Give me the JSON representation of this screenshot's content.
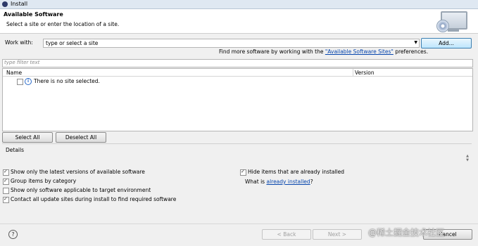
{
  "window": {
    "title": "Install"
  },
  "header": {
    "title": "Available Software",
    "subtitle": "Select a site or enter the location of a site."
  },
  "work_with": {
    "label": "Work with:",
    "value": "type or select a site",
    "add_label": "Add...",
    "more_prefix": "Find more software by working with the ",
    "more_link": "\"Available Software Sites\"",
    "more_suffix": " preferences."
  },
  "filter": {
    "placeholder": "type filter text"
  },
  "table": {
    "columns": [
      "Name",
      "Version"
    ],
    "rows": [
      {
        "name": "There is no site selected.",
        "checked": false
      }
    ]
  },
  "selection": {
    "select_all": "Select All",
    "deselect_all": "Deselect All"
  },
  "details": {
    "label": "Details"
  },
  "options": {
    "latest_versions": {
      "label": "Show only the latest versions of available software",
      "checked": true
    },
    "group_by_category": {
      "label": "Group items by category",
      "checked": true
    },
    "target_env": {
      "label": "Show only software applicable to target environment",
      "checked": false
    },
    "contact_sites": {
      "label": "Contact all update sites during install to find required software",
      "checked": true
    },
    "hide_installed": {
      "label": "Hide items that are already installed",
      "checked": true
    },
    "what_is_prefix": "What is ",
    "what_is_link": "already installed",
    "what_is_suffix": "?"
  },
  "footer": {
    "help": "?",
    "back": "< Back",
    "next": "Next >",
    "cancel": "Cancel"
  },
  "watermark": "@稀土掘金技术社区"
}
